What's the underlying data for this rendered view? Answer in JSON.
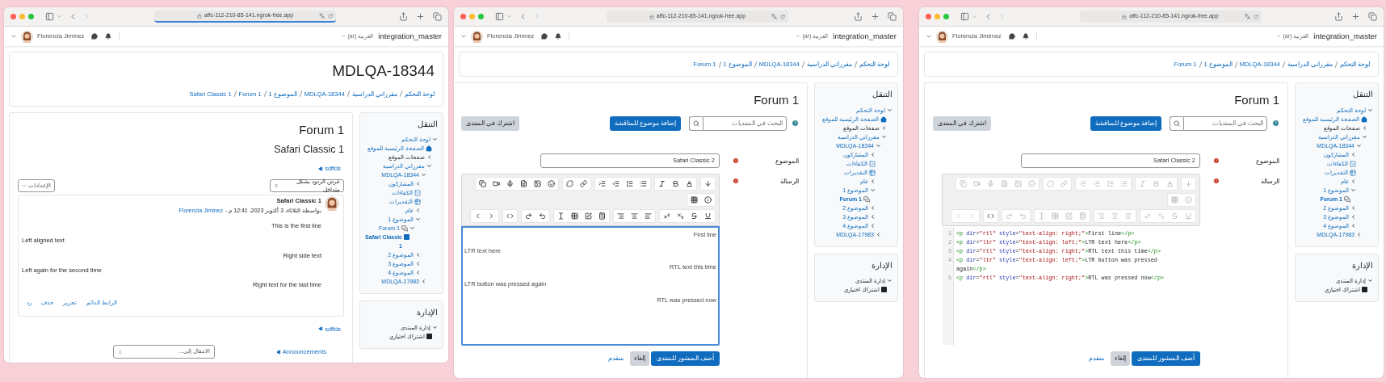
{
  "left_window": {
    "url": "affc-112-210-85-141.ngrok-free.app",
    "loading": true,
    "navbar": {
      "user": "Florencia Jiminez",
      "language": "العربية (ar)",
      "site": "integration_master"
    },
    "header": {
      "title": "MDLQA-18344",
      "breadcrumbs": [
        "لوحة التحكم",
        "مقرراتي الدراسية",
        "MDLQA-18344",
        "الموضوع 1",
        "Forum 1",
        "Safari Classic 1"
      ]
    },
    "navigation": {
      "title": "التنقل",
      "items": [
        {
          "label": "لوحة التحكم",
          "kind": "link",
          "current": false,
          "expanded": true,
          "children": [
            {
              "label": "الصفحة الرئيسية للموقع",
              "kind": "home",
              "current": false
            },
            {
              "label": "صفحات الموقع",
              "kind": "plain",
              "current": false,
              "expanded": false
            },
            {
              "label": "مقرراتي الدراسية",
              "kind": "link",
              "current": false,
              "expanded": true,
              "children": [
                {
                  "label": "MDLQA-18344",
                  "kind": "link",
                  "current": false,
                  "expanded": true,
                  "children": [
                    {
                      "label": "المشاركون",
                      "kind": "link",
                      "current": false,
                      "expanded": false
                    },
                    {
                      "label": "الكفاءات",
                      "kind": "checklist",
                      "current": false
                    },
                    {
                      "label": "التقديرات",
                      "kind": "grid",
                      "current": false
                    },
                    {
                      "label": "عام",
                      "kind": "link",
                      "current": false,
                      "expanded": false
                    },
                    {
                      "label": "الموضوع 1",
                      "kind": "link",
                      "current": false,
                      "expanded": true,
                      "children": [
                        {
                          "label": "Forum 1",
                          "kind": "forum",
                          "current": false,
                          "expanded": true,
                          "children": [
                            {
                              "label": "Safari Classic 1",
                              "kind": "post",
                              "current": true
                            }
                          ]
                        }
                      ]
                    },
                    {
                      "label": "الموضوع 2",
                      "kind": "link",
                      "current": false,
                      "expanded": false
                    },
                    {
                      "label": "الموضوع 3",
                      "kind": "link",
                      "current": false,
                      "expanded": false
                    },
                    {
                      "label": "الموضوع 4",
                      "kind": "link",
                      "current": false,
                      "expanded": false
                    }
                  ]
                },
                {
                  "label": "MDLQA-17983",
                  "kind": "link",
                  "current": false,
                  "expanded": false
                }
              ]
            }
          ]
        }
      ]
    },
    "administration": {
      "title": "الإدارة",
      "items": [
        {
          "label": "إدارة المنتدى",
          "kind": "plain",
          "current": false,
          "expanded": true,
          "children": [
            {
              "label": "اشتراك اختياري",
              "kind": "square",
              "current": false
            }
          ]
        }
      ]
    },
    "main": {
      "kind": "discussion",
      "title": "Forum 1",
      "subtitle": "Safari Classic 1",
      "top_link": "sdffds",
      "display_mode": "عرض الردود بشكل متداخل",
      "settings": "الإعدادات",
      "post": {
        "subject": "Safari Classic 1",
        "byline": "بواسطة الثلاثاء، 3 أكتوبر 2023، 12:41 م -",
        "author": "Florencia Jiminez",
        "lines": [
          {
            "text": "This is the first line",
            "right_aligned": true
          },
          {
            "text": "Left aligned text",
            "right_aligned": false
          },
          {
            "text": "Right side text",
            "right_aligned": true
          },
          {
            "text": "Left again for the second time",
            "right_aligned": false
          },
          {
            "text": "Right text for the last time",
            "right_aligned": true
          }
        ],
        "actions": [
          "الرابط الدائم",
          "تحرير",
          "حذف",
          "رد"
        ]
      },
      "bottom_link": "sdffds",
      "forum_link": "Announcements",
      "jump_placeholder": "الانتقال إلى..."
    }
  },
  "middle_window": {
    "url": "affc-112-210-85-141.ngrok-free.app",
    "loading": false,
    "navbar": {
      "user": "Florencia Jiminez",
      "language": "العربية (ar)",
      "site": "integration_master"
    },
    "header": {
      "breadcrumbs": [
        "لوحة التحكم",
        "مقرراتي الدراسية",
        "MDLQA-18344",
        "الموضوع 1",
        "Forum 1"
      ]
    },
    "navigation": {
      "title": "التنقل",
      "items": [
        {
          "label": "لوحة التحكم",
          "kind": "link",
          "current": false,
          "expanded": true,
          "children": [
            {
              "label": "الصفحة الرئيسية للموقع",
              "kind": "home",
              "current": false
            },
            {
              "label": "صفحات الموقع",
              "kind": "plain",
              "current": false,
              "expanded": false
            },
            {
              "label": "مقرراتي الدراسية",
              "kind": "link",
              "current": false,
              "expanded": true,
              "children": [
                {
                  "label": "MDLQA-18344",
                  "kind": "link",
                  "current": false,
                  "expanded": true,
                  "children": [
                    {
                      "label": "المشاركون",
                      "kind": "link",
                      "current": false,
                      "expanded": false
                    },
                    {
                      "label": "الكفاءات",
                      "kind": "checklist",
                      "current": false
                    },
                    {
                      "label": "التقديرات",
                      "kind": "grid",
                      "current": false
                    },
                    {
                      "label": "عام",
                      "kind": "link",
                      "current": false,
                      "expanded": false
                    },
                    {
                      "label": "الموضوع 1",
                      "kind": "link",
                      "current": false,
                      "expanded": true,
                      "children": [
                        {
                          "label": "Forum 1",
                          "kind": "forum",
                          "current": true
                        }
                      ]
                    },
                    {
                      "label": "الموضوع 2",
                      "kind": "link",
                      "current": false,
                      "expanded": false
                    },
                    {
                      "label": "الموضوع 3",
                      "kind": "link",
                      "current": false,
                      "expanded": false
                    },
                    {
                      "label": "الموضوع 4",
                      "kind": "link",
                      "current": false,
                      "expanded": false
                    }
                  ]
                },
                {
                  "label": "MDLQA-17983",
                  "kind": "link",
                  "current": false,
                  "expanded": false
                }
              ]
            }
          ]
        }
      ]
    },
    "administration": {
      "title": "الإدارة",
      "items": [
        {
          "label": "إدارة المنتدى",
          "kind": "plain",
          "current": false,
          "expanded": true,
          "children": [
            {
              "label": "اشتراك اختياري",
              "kind": "square",
              "current": false
            }
          ]
        }
      ]
    },
    "main": {
      "kind": "post_form",
      "title": "Forum 1",
      "search_placeholder": "البحث في المنتديات",
      "add_button": "إضافة موضوع للمناقشة",
      "subscribe_button": "اشترك في المنتدى",
      "subject": {
        "label": "الموضوع",
        "value": "Safari Classic 2",
        "required": true
      },
      "message": {
        "label": "الرسالة",
        "required": true,
        "editor": {
          "kind": "rich",
          "focused": true,
          "lines": [
            {
              "text": "First line",
              "right_aligned": true
            },
            {
              "text": "LTR text here",
              "right_aligned": false
            },
            {
              "text": "RTL text this time",
              "right_aligned": true
            },
            {
              "text": "LTR button was pressed again",
              "right_aligned": false
            },
            {
              "text": "RTL was pressed now",
              "right_aligned": true
            }
          ]
        }
      },
      "buttons": [
        {
          "label": "أضف المنشور للمنتدى",
          "kind": "primary"
        },
        {
          "label": "إلغاء",
          "kind": "secondary"
        },
        {
          "label": "متقدم",
          "kind": "link"
        }
      ]
    }
  },
  "right_window": {
    "url": "affc-112-210-85-141.ngrok-free.app",
    "loading": false,
    "navbar": {
      "user": "Florencia Jiménez",
      "language": "العربية (ar)",
      "site": "integration_master"
    },
    "header": {
      "breadcrumbs": [
        "لوحة التحكم",
        "مقرراتي الدراسية",
        "MDLQA-18344",
        "الموضوع 1",
        "Forum 1"
      ]
    },
    "navigation": {
      "title": "التنقل",
      "items": [
        {
          "label": "لوحة التحكم",
          "kind": "link",
          "current": false,
          "expanded": true,
          "children": [
            {
              "label": "الصفحة الرئيسية للموقع",
              "kind": "home",
              "current": false
            },
            {
              "label": "صفحات الموقع",
              "kind": "plain",
              "current": false,
              "expanded": false
            },
            {
              "label": "مقرراتي الدراسية",
              "kind": "link",
              "current": false,
              "expanded": true,
              "children": [
                {
                  "label": "MDLQA-18344",
                  "kind": "link",
                  "current": false,
                  "expanded": true,
                  "children": [
                    {
                      "label": "المشاركون",
                      "kind": "link",
                      "current": false,
                      "expanded": false
                    },
                    {
                      "label": "الكفاءات",
                      "kind": "checklist",
                      "current": false
                    },
                    {
                      "label": "التقديرات",
                      "kind": "grid",
                      "current": false
                    },
                    {
                      "label": "عام",
                      "kind": "link",
                      "current": false,
                      "expanded": false
                    },
                    {
                      "label": "الموضوع 1",
                      "kind": "link",
                      "current": false,
                      "expanded": true,
                      "children": [
                        {
                          "label": "Forum 1",
                          "kind": "forum",
                          "current": true
                        }
                      ]
                    },
                    {
                      "label": "الموضوع 2",
                      "kind": "link",
                      "current": false,
                      "expanded": false
                    },
                    {
                      "label": "الموضوع 3",
                      "kind": "link",
                      "current": false,
                      "expanded": false
                    },
                    {
                      "label": "الموضوع 4",
                      "kind": "link",
                      "current": false,
                      "expanded": false
                    }
                  ]
                },
                {
                  "label": "MDLQA-17983",
                  "kind": "link",
                  "current": false,
                  "expanded": false
                }
              ]
            }
          ]
        }
      ]
    },
    "administration": {
      "title": "الإدارة",
      "items": [
        {
          "label": "إدارة المنتدى",
          "kind": "plain",
          "current": false,
          "expanded": true,
          "children": [
            {
              "label": "اشتراك اختياري",
              "kind": "square",
              "current": false
            }
          ]
        }
      ]
    },
    "main": {
      "kind": "post_form",
      "title": "Forum 1",
      "search_placeholder": "البحث في المنتديات",
      "add_button": "إضافة موضوع للمناقشة",
      "subscribe_button": "اشترك في المنتدى",
      "subject": {
        "label": "الموضوع",
        "value": "Safari Classic 2",
        "required": true
      },
      "message": {
        "label": "الرسالة",
        "required": true,
        "editor": {
          "kind": "source",
          "focused": false,
          "lines": [
            {
              "number": "1",
              "code": "<p dir=\"rtl\" style=\"text-align: right;\">First line</p>"
            },
            {
              "number": "2",
              "code": "<p dir=\"ltr\" style=\"text-align: left;\">LTR text here</p>"
            },
            {
              "number": "3",
              "code": "<p dir=\"rtl\" style=\"text-align: right;\">RTL text this time</p>"
            },
            {
              "number": "4",
              "code": "<p dir=\"ltr\" style=\"text-align: left;\">LTR button was pressed again</p>"
            },
            {
              "number": "5",
              "code": "<p dir=\"rtl\" style=\"text-align: right;\">RTL was pressed now</p>"
            }
          ]
        }
      },
      "buttons": [
        {
          "label": "أضف المنشور للمنتدى",
          "kind": "primary"
        },
        {
          "label": "إلغاء",
          "kind": "secondary"
        },
        {
          "label": "متقدم",
          "kind": "link"
        }
      ]
    }
  }
}
